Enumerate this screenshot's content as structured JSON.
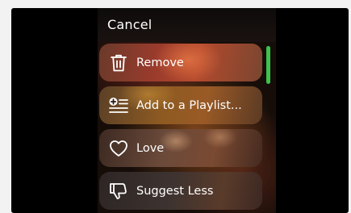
{
  "header": {
    "cancel_label": "Cancel"
  },
  "menu": {
    "items": [
      {
        "label": "Remove",
        "icon": "trash-icon"
      },
      {
        "label": "Add to a Playlist...",
        "icon": "add-to-playlist-icon"
      },
      {
        "label": "Love",
        "icon": "heart-icon"
      },
      {
        "label": "Suggest Less",
        "icon": "thumbs-down-icon"
      }
    ]
  },
  "colors": {
    "scroll_accent": "#3ec24e",
    "background": "#000000"
  }
}
